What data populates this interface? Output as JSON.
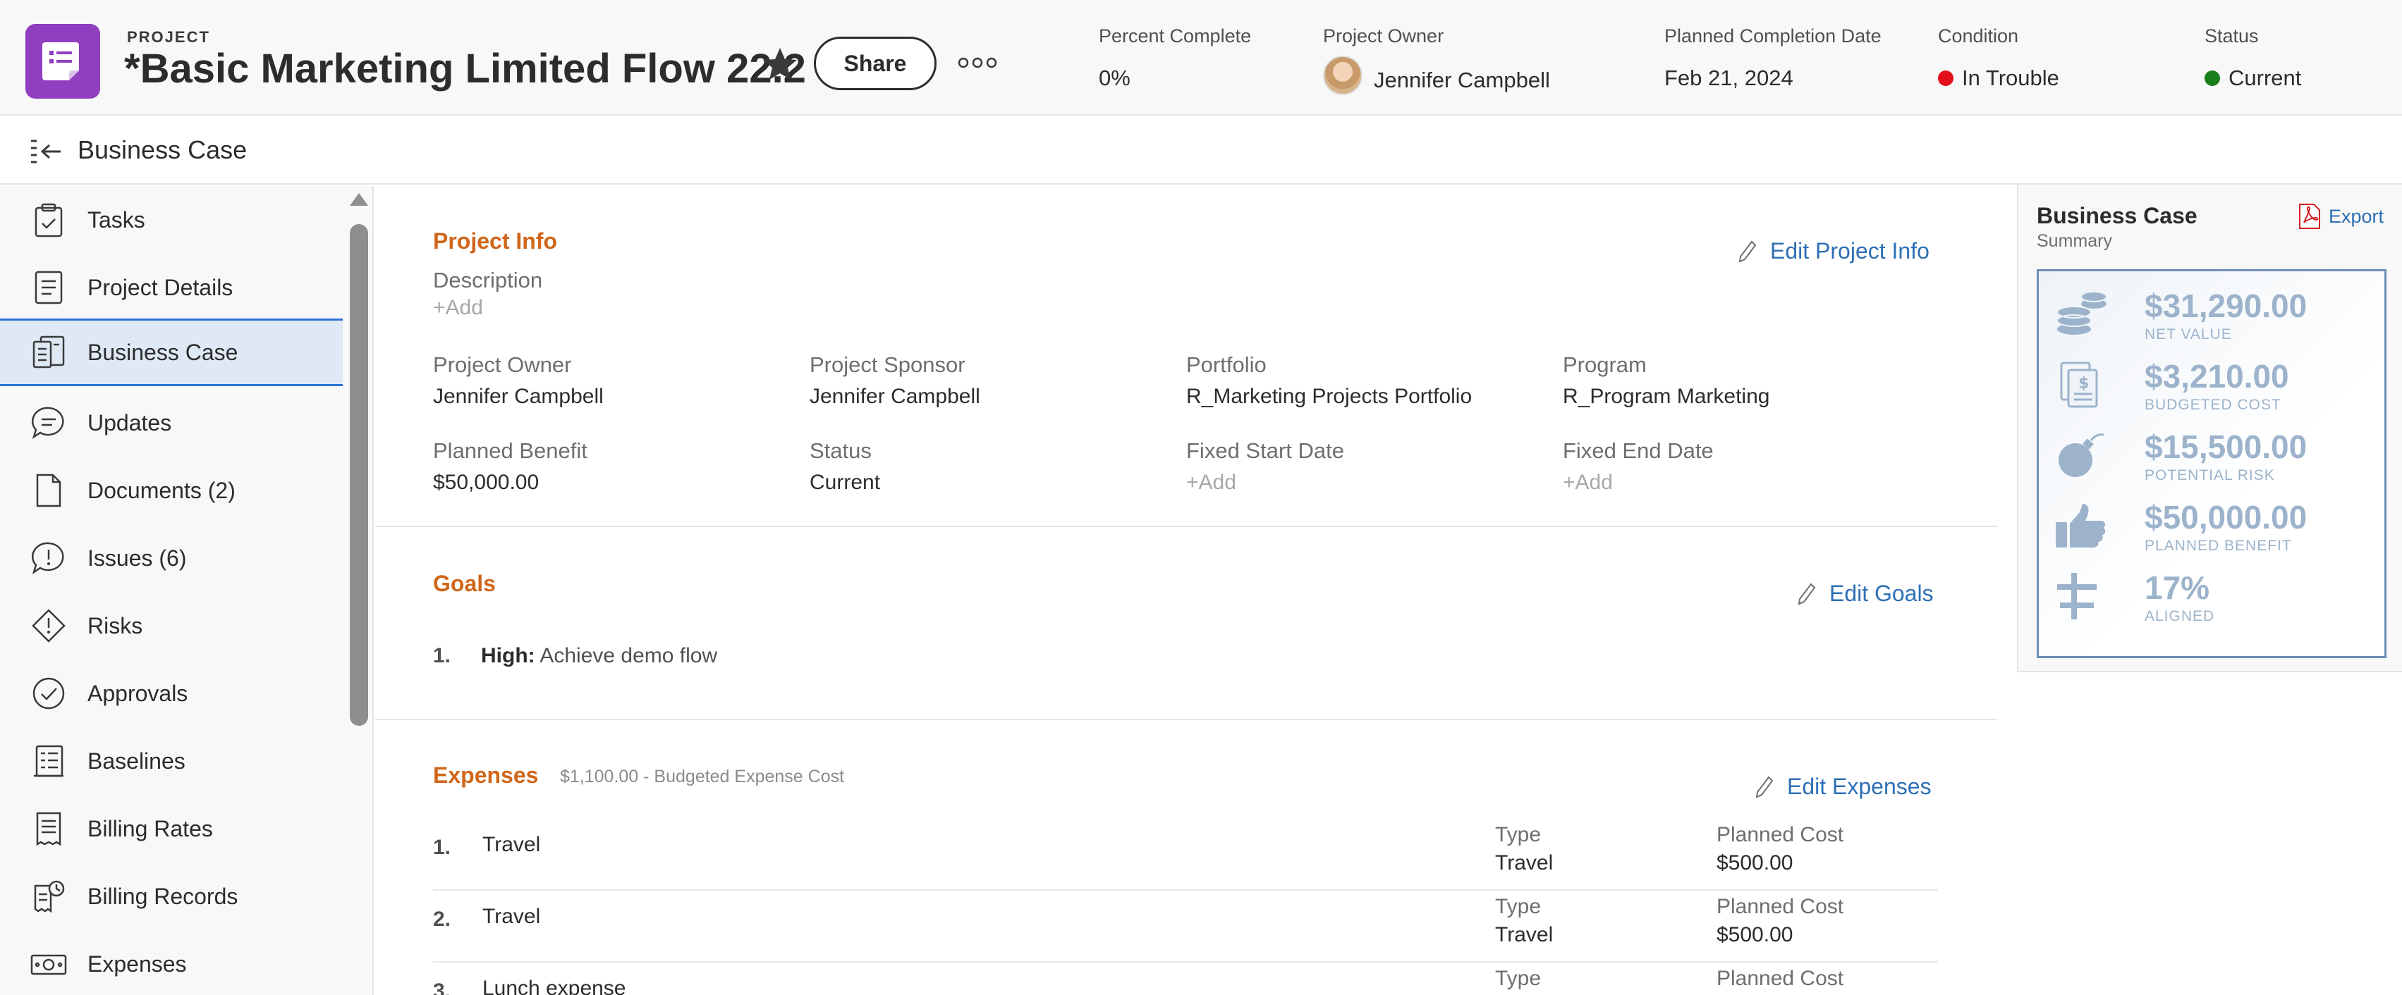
{
  "header": {
    "label": "PROJECT",
    "title": "*Basic Marketing Limited Flow 22.2",
    "share_label": "Share",
    "fields": {
      "percent_complete": {
        "label": "Percent Complete",
        "value": "0%"
      },
      "project_owner": {
        "label": "Project Owner",
        "value": "Jennifer Campbell"
      },
      "planned_completion": {
        "label": "Planned Completion Date",
        "value": "Feb 21, 2024"
      },
      "condition": {
        "label": "Condition",
        "value": "In Trouble",
        "color": "#e3101b"
      },
      "status": {
        "label": "Status",
        "value": "Current",
        "color": "#1a7f1a"
      }
    }
  },
  "subheader": {
    "title": "Business Case"
  },
  "sidebar": {
    "items": [
      {
        "label": "Tasks",
        "icon": "clipboard-check-icon"
      },
      {
        "label": "Project Details",
        "icon": "document-lines-icon"
      },
      {
        "label": "Business Case",
        "icon": "business-case-icon",
        "active": true
      },
      {
        "label": "Updates",
        "icon": "speech-bubble-icon"
      },
      {
        "label": "Documents (2)",
        "icon": "file-icon"
      },
      {
        "label": "Issues (6)",
        "icon": "alert-bubble-icon"
      },
      {
        "label": "Risks",
        "icon": "diamond-alert-icon"
      },
      {
        "label": "Approvals",
        "icon": "check-circle-icon"
      },
      {
        "label": "Baselines",
        "icon": "baseline-icon"
      },
      {
        "label": "Billing Rates",
        "icon": "receipt-icon"
      },
      {
        "label": "Billing Records",
        "icon": "billing-clock-icon"
      },
      {
        "label": "Expenses",
        "icon": "money-icon"
      }
    ]
  },
  "project_info": {
    "title": "Project Info",
    "edit_label": "Edit Project Info",
    "description_label": "Description",
    "description_value": "+Add",
    "fields": [
      {
        "label": "Project Owner",
        "value": "Jennifer Campbell"
      },
      {
        "label": "Project Sponsor",
        "value": "Jennifer Campbell"
      },
      {
        "label": "Portfolio",
        "value": "R_Marketing Projects Portfolio"
      },
      {
        "label": "Program",
        "value": "R_Program Marketing"
      },
      {
        "label": "Planned Benefit",
        "value": "$50,000.00"
      },
      {
        "label": "Status",
        "value": "Current"
      },
      {
        "label": "Fixed Start Date",
        "value": "+Add"
      },
      {
        "label": "Fixed End Date",
        "value": "+Add"
      }
    ]
  },
  "goals": {
    "title": "Goals",
    "edit_label": "Edit Goals",
    "items": [
      {
        "num": "1.",
        "priority": "High:",
        "text": "Achieve demo flow"
      }
    ]
  },
  "expenses": {
    "title": "Expenses",
    "subtitle": "$1,100.00 - Budgeted Expense Cost",
    "edit_label": "Edit Expenses",
    "type_label": "Type",
    "cost_label": "Planned Cost",
    "rows": [
      {
        "num": "1.",
        "name": "Travel",
        "type": "Travel",
        "cost": "$500.00"
      },
      {
        "num": "2.",
        "name": "Travel",
        "type": "Travel",
        "cost": "$500.00"
      },
      {
        "num": "3.",
        "name": "Lunch expense",
        "type": "",
        "cost": ""
      }
    ]
  },
  "summary": {
    "title": "Business Case",
    "subtitle": "Summary",
    "export_label": "Export",
    "metrics": [
      {
        "value": "$31,290.00",
        "label": "NET VALUE",
        "icon": "coins-icon"
      },
      {
        "value": "$3,210.00",
        "label": "BUDGETED COST",
        "icon": "budget-document-icon"
      },
      {
        "value": "$15,500.00",
        "label": "POTENTIAL RISK",
        "icon": "bomb-icon"
      },
      {
        "value": "$50,000.00",
        "label": "PLANNED BENEFIT",
        "icon": "thumbs-up-icon"
      },
      {
        "value": "17%",
        "label": "ALIGNED",
        "icon": "align-icon"
      }
    ]
  }
}
